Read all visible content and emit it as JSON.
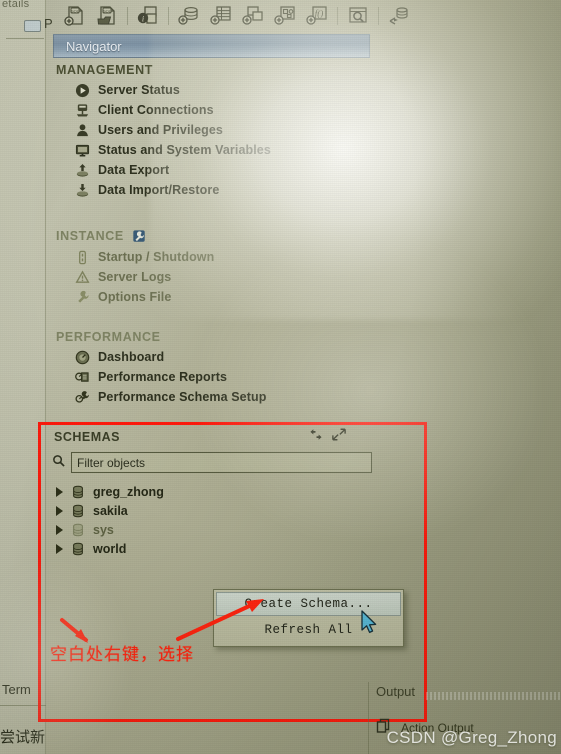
{
  "window": {
    "navigator_title": "Navigator"
  },
  "toolbar": {
    "buttons": [
      {
        "name": "new-sql-file-icon",
        "title": "New SQL File"
      },
      {
        "name": "open-sql-file-icon",
        "title": "Open SQL File"
      },
      {
        "name": "table-info-icon",
        "title": "Table Info"
      },
      {
        "name": "new-schema-icon",
        "title": "Create New Schema"
      },
      {
        "name": "new-table-icon",
        "title": "Create New Table"
      },
      {
        "name": "new-view-icon",
        "title": "Create New View"
      },
      {
        "name": "new-procedure-icon",
        "title": "Create New Stored Procedure"
      },
      {
        "name": "new-function-icon",
        "title": "Create New Function"
      },
      {
        "name": "search-table-data-icon",
        "title": "Search Table Data"
      },
      {
        "name": "reconnect-server-icon",
        "title": "Reconnect to DBMS"
      }
    ]
  },
  "navigator": {
    "sections": [
      {
        "heading": "MANAGEMENT",
        "icon": null,
        "items": [
          {
            "label": "Server Status",
            "icon": "server-status-icon",
            "dim": false
          },
          {
            "label": "Client Connections",
            "icon": "client-connections-icon",
            "dim": false
          },
          {
            "label": "Users and Privileges",
            "icon": "users-privileges-icon",
            "dim": false
          },
          {
            "label": "Status and System Variables",
            "icon": "status-variables-icon",
            "dim": false
          },
          {
            "label": "Data Export",
            "icon": "data-export-icon",
            "dim": false
          },
          {
            "label": "Data Import/Restore",
            "icon": "data-import-icon",
            "dim": false
          }
        ]
      },
      {
        "heading": "INSTANCE",
        "icon": "instance-wrench-icon",
        "items": [
          {
            "label": "Startup / Shutdown",
            "icon": "startup-shutdown-icon",
            "dim": true
          },
          {
            "label": "Server Logs",
            "icon": "server-logs-icon",
            "dim": true
          },
          {
            "label": "Options File",
            "icon": "options-file-icon",
            "dim": true
          }
        ]
      },
      {
        "heading": "PERFORMANCE",
        "icon": null,
        "items": [
          {
            "label": "Dashboard",
            "icon": "dashboard-icon",
            "dim": false
          },
          {
            "label": "Performance Reports",
            "icon": "performance-reports-icon",
            "dim": false
          },
          {
            "label": "Performance Schema Setup",
            "icon": "performance-schema-setup-icon",
            "dim": false
          }
        ]
      }
    ]
  },
  "schemas": {
    "heading": "SCHEMAS",
    "refresh_icon": "refresh-schemas-icon",
    "expand_icon": "expand-panel-icon",
    "search_icon": "search-icon",
    "filter_placeholder": "Filter objects",
    "filter_value": "Filter objects",
    "tree": [
      {
        "name": "greg_zhong",
        "dim": false
      },
      {
        "name": "sakila",
        "dim": false
      },
      {
        "name": "sys",
        "dim": true
      },
      {
        "name": "world",
        "dim": false
      }
    ]
  },
  "context_menu": {
    "items": [
      {
        "label": "Create Schema...",
        "highlighted": true
      },
      {
        "label": "Refresh All",
        "highlighted": false
      }
    ]
  },
  "annotation": {
    "text": "空白处右键，选择",
    "box_color": "#ff1a0d",
    "arrow_color": "#ff2410"
  },
  "bottom": {
    "left_tab": "Term",
    "left_chinese": "尝试新",
    "output_title": "Output",
    "output_row_label": "Action Output",
    "output_row_icon": "action-output-icon"
  },
  "watermark": {
    "text": "CSDN @Greg_Zhong"
  },
  "left_edge": {
    "top_text": "etails",
    "p_label": "P"
  }
}
